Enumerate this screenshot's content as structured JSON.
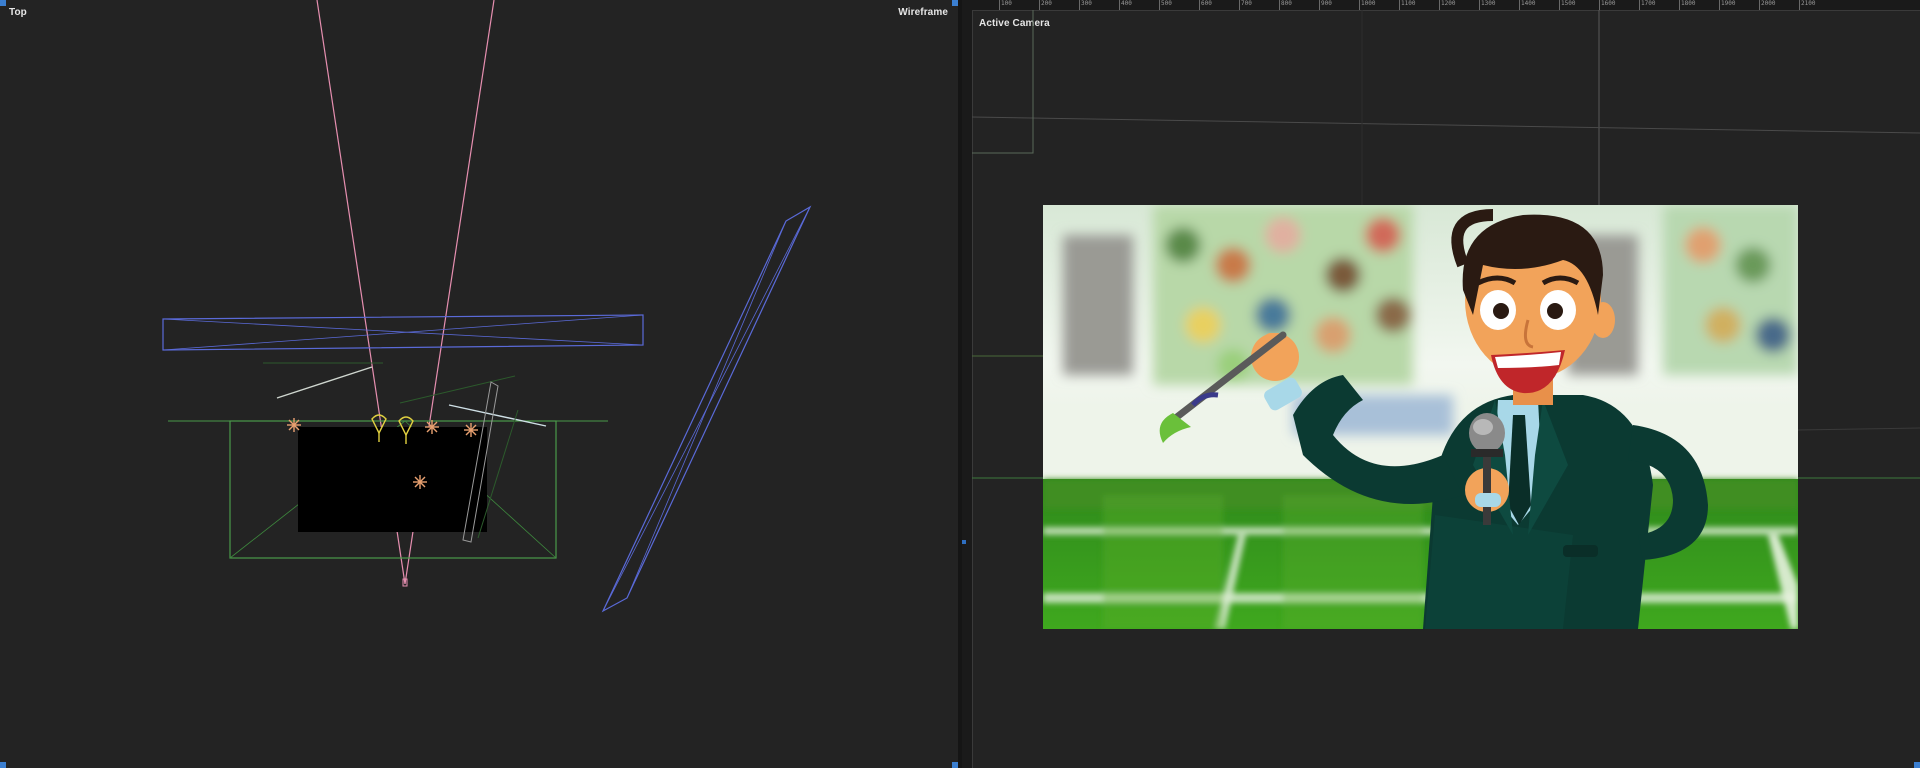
{
  "viewports": {
    "left": {
      "name": "Top",
      "render_mode": "Wireframe"
    },
    "right": {
      "name": "Active Camera",
      "ruler_labels": [
        "100",
        "200",
        "300",
        "400",
        "500",
        "600",
        "700",
        "800",
        "900",
        "1000",
        "1100",
        "1200",
        "1300",
        "1400",
        "1500",
        "1600",
        "1700",
        "1800",
        "1900",
        "2000",
        "2100"
      ]
    }
  },
  "colors": {
    "background": "#232323",
    "camera_cone": "#e68fb0",
    "light_icon": "#e8a070",
    "spot_light": "#e0d040",
    "blue_layer": "#5a6ad8",
    "green_layer": "#4a9a4a",
    "accent": "#3b7fd1"
  },
  "icons": [
    "camera-icon",
    "point-light-icon",
    "spot-light-icon"
  ]
}
